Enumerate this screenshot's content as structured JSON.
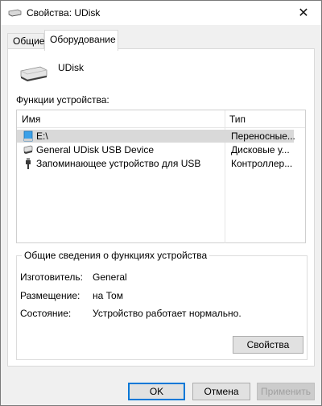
{
  "window": {
    "title": "Свойства: UDisk"
  },
  "tabs": [
    {
      "label": "Общие",
      "active": false
    },
    {
      "label": "Оборудование",
      "active": true
    }
  ],
  "device": {
    "name": "UDisk",
    "icon": "usb-drive-icon"
  },
  "functions": {
    "label": "Функции устройства:",
    "columns": [
      "Имя",
      "Тип"
    ],
    "rows": [
      {
        "name": "E:\\",
        "type": "Переносные...",
        "icon": "volume-icon",
        "selected": true
      },
      {
        "name": "General UDisk USB Device",
        "type": "Дисковые у...",
        "icon": "disk-icon",
        "selected": false
      },
      {
        "name": "Запоминающее устройство для USB",
        "type": "Контроллер...",
        "icon": "usb-plug-icon",
        "selected": false
      }
    ]
  },
  "summary": {
    "title": "Общие сведения о функциях устройства",
    "manufacturer_label": "Изготовитель:",
    "manufacturer_value": "General",
    "location_label": "Размещение:",
    "location_value": "на Том",
    "status_label": "Состояние:",
    "status_value": "Устройство работает нормально.",
    "properties_button": "Свойства"
  },
  "footer": {
    "ok": "OK",
    "cancel": "Отмена",
    "apply": "Применить"
  },
  "colors": {
    "accent": "#0078d7",
    "selection": "#d9d9d9"
  }
}
